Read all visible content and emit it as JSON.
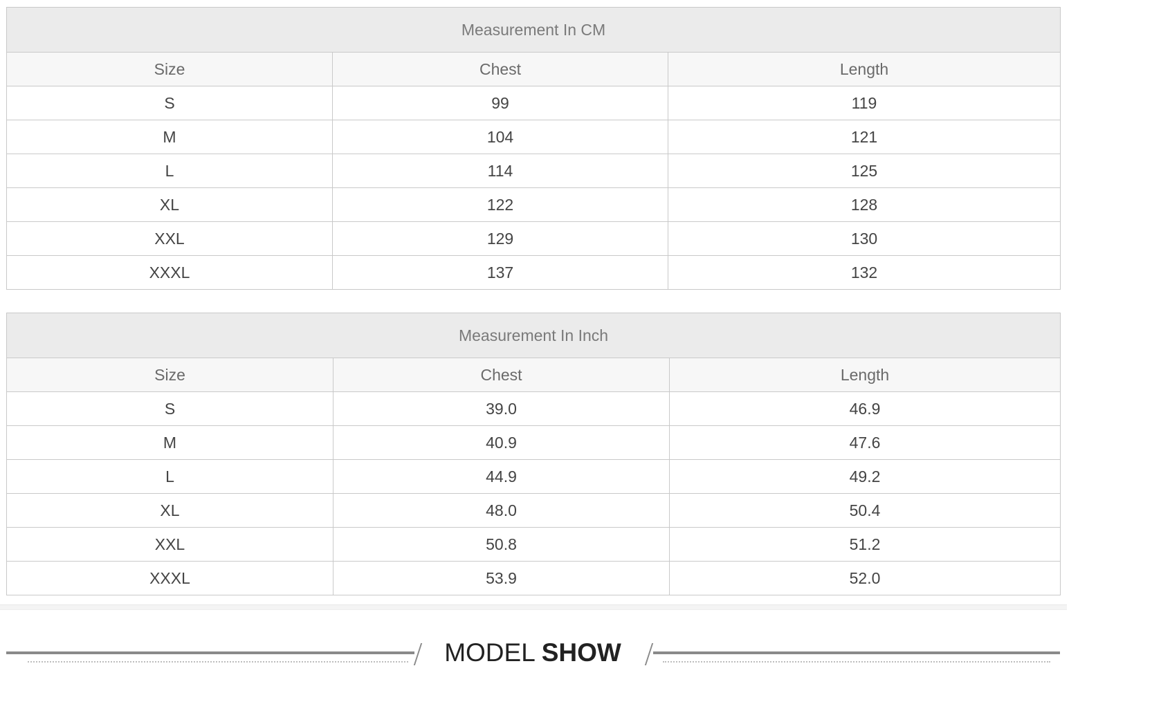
{
  "tables": [
    {
      "title": "Measurement In CM",
      "headers": [
        "Size",
        "Chest",
        "Length"
      ],
      "rows": [
        [
          "S",
          "99",
          "119"
        ],
        [
          "M",
          "104",
          "121"
        ],
        [
          "L",
          "114",
          "125"
        ],
        [
          "XL",
          "122",
          "128"
        ],
        [
          "XXL",
          "129",
          "130"
        ],
        [
          "XXXL",
          "137",
          "132"
        ]
      ]
    },
    {
      "title": "Measurement In Inch",
      "headers": [
        "Size",
        "Chest",
        "Length"
      ],
      "rows": [
        [
          "S",
          "39.0",
          "46.9"
        ],
        [
          "M",
          "40.9",
          "47.6"
        ],
        [
          "L",
          "44.9",
          "49.2"
        ],
        [
          "XL",
          "48.0",
          "50.4"
        ],
        [
          "XXL",
          "50.8",
          "51.2"
        ],
        [
          "XXXL",
          "53.9",
          "52.0"
        ]
      ]
    }
  ],
  "section": {
    "title_light": "MODEL ",
    "title_bold": "SHOW"
  }
}
